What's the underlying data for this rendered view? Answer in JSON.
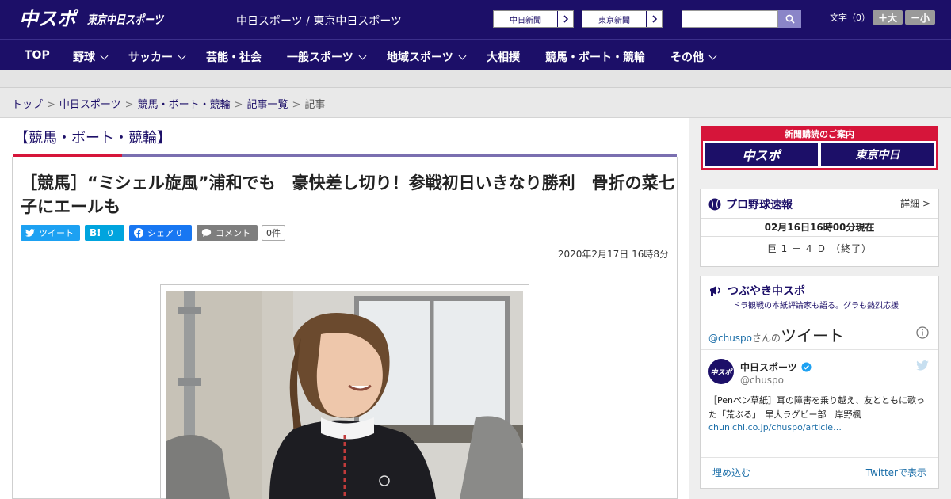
{
  "header": {
    "logo_chuspo": "中スポ",
    "logo_tokyo": "東京中日スポーツ",
    "site_label": "中日スポーツ / 東京中日スポーツ",
    "paper_links": [
      "中日新聞",
      "東京新聞"
    ],
    "search_placeholder": "",
    "font_size_label": "文字（0）",
    "font_plus": "＋大",
    "font_minus": "－小"
  },
  "nav": {
    "items": [
      {
        "label": "TOP",
        "dropdown": false
      },
      {
        "label": "野球",
        "dropdown": true
      },
      {
        "label": "サッカー",
        "dropdown": true
      },
      {
        "label": "芸能・社会",
        "dropdown": false
      },
      {
        "label": "一般スポーツ",
        "dropdown": true
      },
      {
        "label": "地域スポーツ",
        "dropdown": true
      },
      {
        "label": "大相撲",
        "dropdown": false
      },
      {
        "label": "競馬・ボート・競輪",
        "dropdown": false
      },
      {
        "label": "その他",
        "dropdown": true
      }
    ]
  },
  "breadcrumb": {
    "items": [
      "トップ",
      "中日スポーツ",
      "競馬・ボート・競輪",
      "記事一覧",
      "記事"
    ],
    "separator": ">"
  },
  "article": {
    "category": "【競馬・ボート・競輪】",
    "headline": "［競馬］“ミシェル旋風”浦和でも　豪快差し切り！参戦初日いきなり勝利　骨折の菜七子にエールも",
    "share": {
      "tweet": "ツイート",
      "hatena_count": "0",
      "facebook": "シェア 0",
      "comment": "コメント",
      "comment_count": "0件"
    },
    "date": "2020年2月17日 16時8分"
  },
  "sidebar": {
    "promo_title": "新聞購読のご案内",
    "promo_logos": [
      "中スポ",
      "東京中日"
    ],
    "baseball": {
      "title": "プロ野球速報",
      "detail": "詳細 >",
      "date": "02月16日16時00分現在",
      "score": "巨 1 － 4 Ｄ （終了）"
    },
    "twitter": {
      "title": "つぶやき中スポ",
      "subtitle": "ドラ観戦の本紙評論家も語る。グラも熱烈応援",
      "handle_prefix": "@chuspo",
      "handle_suffix": "さんの",
      "tweets_label": "ツイート",
      "account_name": "中日スポーツ",
      "account_handle": "@chuspo",
      "avatar_text": "中スポ",
      "tweet_text": "［Penペン草紙］耳の障害を乗り越え、友とともに歌った「荒ぶる」　早大ラグビー部　岸野楓",
      "tweet_link": "chunichi.co.jp/chuspo/article…",
      "embed": "埋め込む",
      "view_on": "Twitterで表示"
    }
  },
  "colors": {
    "brand_navy": "#1c0f68",
    "brand_red": "#d6153a",
    "twitter_blue": "#1da1f2",
    "facebook_blue": "#1877f2",
    "hatena_blue": "#00a4de"
  }
}
